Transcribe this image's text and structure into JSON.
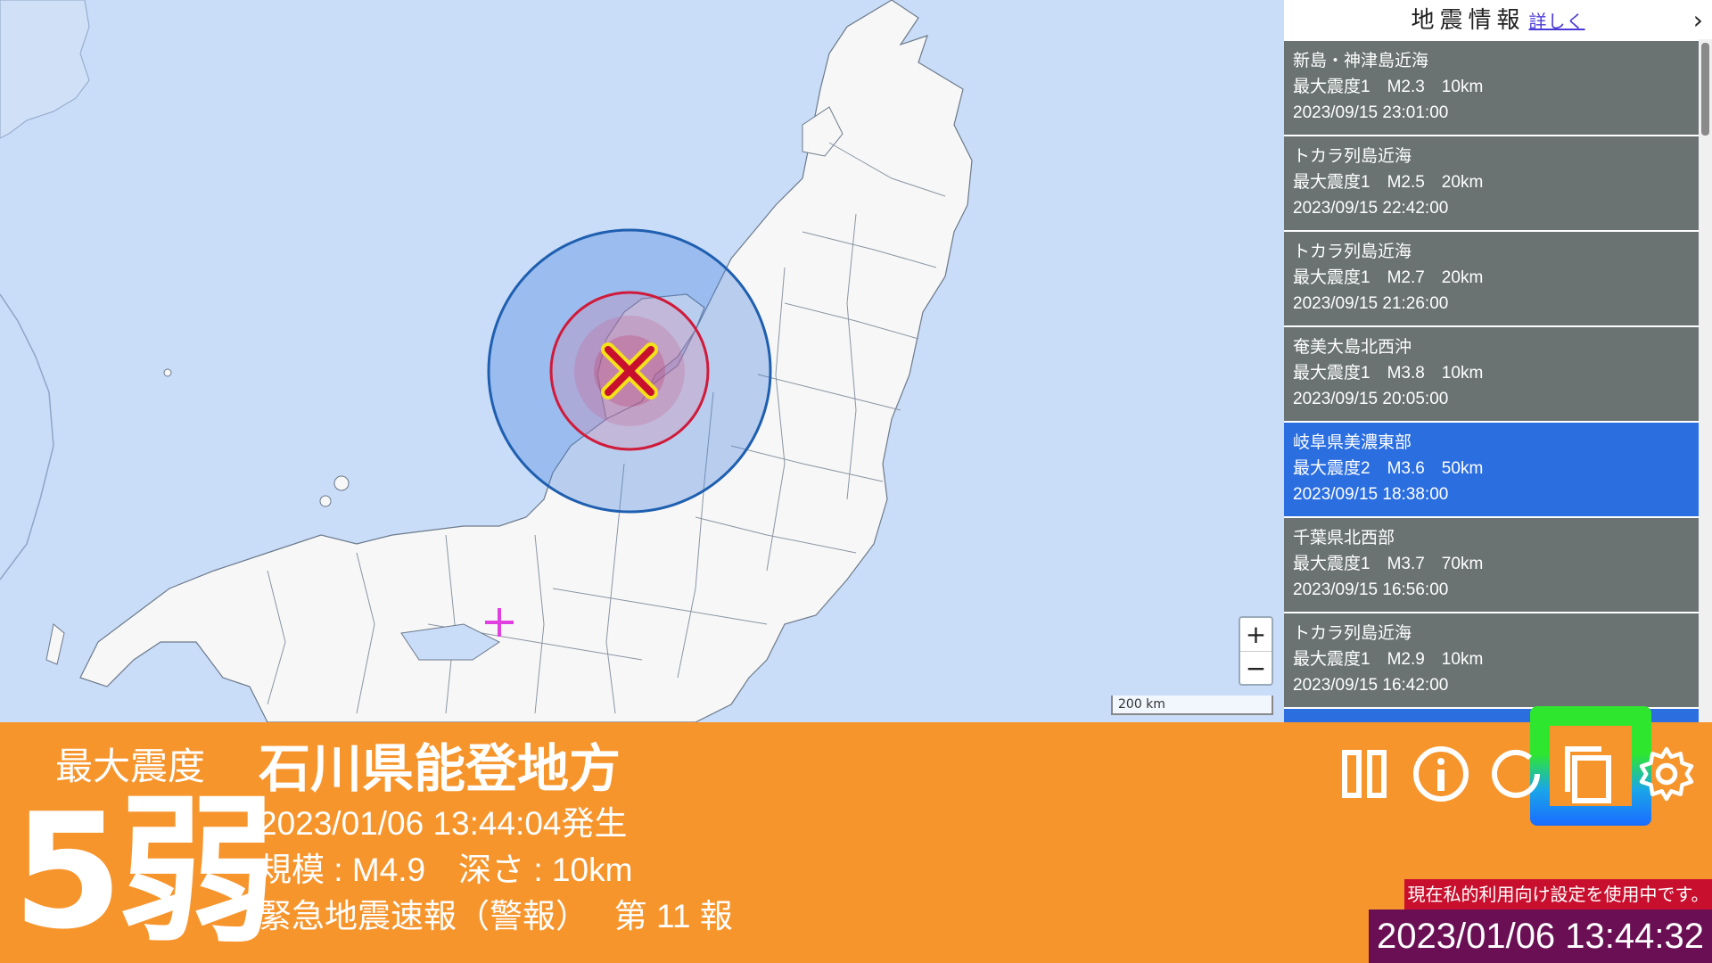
{
  "sidebar": {
    "title": "地震情報",
    "more_link": "詳しく",
    "chevron": "›",
    "items": [
      {
        "place": "新島・神津島近海",
        "detail": "最大震度1　M2.3　10km",
        "time": "2023/09/15 23:01:00",
        "selected": false
      },
      {
        "place": "トカラ列島近海",
        "detail": "最大震度1　M2.5　20km",
        "time": "2023/09/15 22:42:00",
        "selected": false
      },
      {
        "place": "トカラ列島近海",
        "detail": "最大震度1　M2.7　20km",
        "time": "2023/09/15 21:26:00",
        "selected": false
      },
      {
        "place": "奄美大島北西沖",
        "detail": "最大震度1　M3.8　10km",
        "time": "2023/09/15 20:05:00",
        "selected": false
      },
      {
        "place": "岐阜県美濃東部",
        "detail": "最大震度2　M3.6　50km",
        "time": "2023/09/15 18:38:00",
        "selected": true
      },
      {
        "place": "千葉県北西部",
        "detail": "最大震度1　M3.7　70km",
        "time": "2023/09/15 16:56:00",
        "selected": false
      },
      {
        "place": "トカラ列島近海",
        "detail": "最大震度1　M2.9　10km",
        "time": "2023/09/15 16:42:00",
        "selected": false
      }
    ]
  },
  "map": {
    "zoom_in": "+",
    "zoom_out": "−",
    "scale_label": "200 km"
  },
  "panel": {
    "max_intensity_label": "最大震度",
    "max_intensity_value": "5弱",
    "region": "石川県能登地方",
    "occurred": "2023/01/06 13:44:04発生",
    "scale_depth": "規模 : M4.9　深さ : 10km",
    "report": "緊急地震速報（警報）　 第 11 報",
    "notice": "現在私的利用向け設定を使用中です。",
    "clock": "2023/01/06 13:44:32"
  },
  "icons": [
    "pause-icon",
    "info-icon",
    "refresh-icon",
    "copy-icon",
    "gear-icon"
  ],
  "colors": {
    "panel": "#f7952d",
    "sea": "#c9dcf8",
    "list_item": "#6a7372",
    "list_selected": "#2b6ee0",
    "notice": "#c8102e",
    "clock_bg": "#6b0f55",
    "p_wave": "#1f5fb0",
    "s_wave": "#d01a3a"
  }
}
